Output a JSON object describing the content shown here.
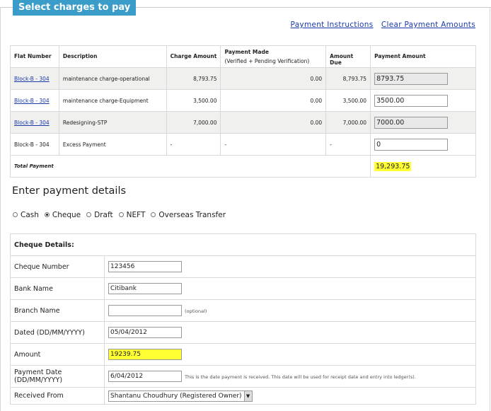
{
  "section_title": "Select charges to pay",
  "links": {
    "payment_instructions": "Payment Instructions",
    "clear_amounts": "Clear Payment Amounts"
  },
  "charges_table": {
    "headers": {
      "flat": "Flat Number",
      "description": "Description",
      "charge": "Charge Amount",
      "paid": "Payment Made",
      "paid_sub": "(Verified + Pending Verification)",
      "due": "Amount Due",
      "payment": "Payment Amount"
    },
    "rows": [
      {
        "flat": "Block-B - 304",
        "description": "maintenance charge-operational",
        "charge": "8,793.75",
        "paid": "0.00",
        "due": "8,793.75",
        "payment": "8793.75"
      },
      {
        "flat": "Block-B - 304",
        "description": "maintenance charge-Equipment",
        "charge": "3,500.00",
        "paid": "0.00",
        "due": "3,500.00",
        "payment": "3500.00"
      },
      {
        "flat": "Block-B - 304",
        "description": "Redesigning-STP",
        "charge": "7,000.00",
        "paid": "0.00",
        "due": "7,000.00",
        "payment": "7000.00"
      },
      {
        "flat": "Block-B - 304",
        "description": "Excess Payment",
        "charge": "-",
        "paid": "-",
        "due": "-",
        "payment": "0"
      }
    ],
    "total_label": "Total Payment",
    "total_value": "19,293.75"
  },
  "payment_heading": "Enter payment details",
  "methods": [
    "Cash",
    "Cheque",
    "Draft",
    "NEFT",
    "Overseas Transfer"
  ],
  "selected_method": "Cheque",
  "cheque": {
    "title": "Cheque Details:",
    "fields": {
      "number_label": "Cheque Number",
      "number": "123456",
      "bank_label": "Bank Name",
      "bank": "Citibank",
      "branch_label": "Branch Name",
      "branch": "",
      "optional": "(optional)",
      "dated_label": "Dated (DD/MM/YYYY)",
      "dated": "05/04/2012",
      "amount_label": "Amount",
      "amount": "19239.75",
      "paydate_label": "Payment Date (DD/MM/YYYY)",
      "paydate": "6/04/2012",
      "paydate_note": "This is the date payment is received. This date will be used for receipt date and entry into ledger(s).",
      "received_label": "Received From",
      "received": "Shantanu Choudhury (Registered Owner)"
    }
  },
  "colors": {
    "header_blue": "#3a9cc8",
    "highlight": "#ffff33",
    "link": "#1a3aa8"
  }
}
